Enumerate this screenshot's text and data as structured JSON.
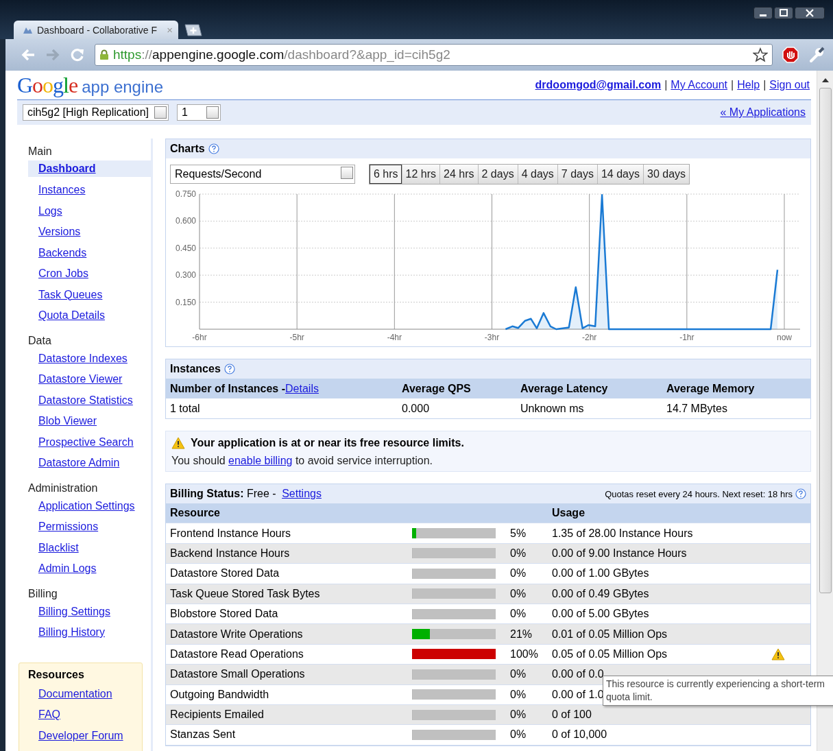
{
  "browser": {
    "tab_title": "Dashboard - Collaborative F",
    "tab_close": "×",
    "url_scheme": "https",
    "url_sep": "://",
    "url_host": "appengine.google.com",
    "url_path": "/dashboard?&app_id=cih5g2"
  },
  "header": {
    "logo_google": "Google",
    "logo_product": "app engine",
    "user_email": "drdoomgod@gmail.com",
    "separators": [
      "|",
      "|",
      "|"
    ],
    "links": [
      "My Account",
      "Help",
      "Sign out"
    ]
  },
  "app_bar": {
    "app_select": "cih5g2 [High Replication]",
    "version_select": "1",
    "my_applications": "« My Applications"
  },
  "sidebar": {
    "sections": [
      {
        "title": "Main",
        "items": [
          {
            "label": "Dashboard",
            "selected": true
          },
          {
            "label": "Instances",
            "selected": false
          },
          {
            "label": "Logs",
            "selected": false
          },
          {
            "label": "Versions",
            "selected": false
          },
          {
            "label": "Backends",
            "selected": false
          },
          {
            "label": "Cron Jobs",
            "selected": false
          },
          {
            "label": "Task Queues",
            "selected": false
          },
          {
            "label": "Quota Details",
            "selected": false
          }
        ]
      },
      {
        "title": "Data",
        "items": [
          {
            "label": "Datastore Indexes",
            "selected": false
          },
          {
            "label": "Datastore Viewer",
            "selected": false
          },
          {
            "label": "Datastore Statistics",
            "selected": false
          },
          {
            "label": "Blob Viewer",
            "selected": false
          },
          {
            "label": "Prospective Search",
            "selected": false
          },
          {
            "label": "Datastore Admin",
            "selected": false
          }
        ]
      },
      {
        "title": "Administration",
        "items": [
          {
            "label": "Application Settings",
            "selected": false
          },
          {
            "label": "Permissions",
            "selected": false
          },
          {
            "label": "Blacklist",
            "selected": false
          },
          {
            "label": "Admin Logs",
            "selected": false
          }
        ]
      },
      {
        "title": "Billing",
        "items": [
          {
            "label": "Billing Settings",
            "selected": false
          },
          {
            "label": "Billing History",
            "selected": false
          }
        ]
      }
    ],
    "resources": {
      "title": "Resources",
      "items": [
        "Documentation",
        "FAQ",
        "Developer Forum"
      ]
    }
  },
  "charts": {
    "title": "Charts",
    "metric_select": "Requests/Second",
    "ranges": [
      {
        "label": "6 hrs",
        "selected": true
      },
      {
        "label": "12 hrs",
        "selected": false
      },
      {
        "label": "24 hrs",
        "selected": false
      },
      {
        "label": "2 days",
        "selected": false
      },
      {
        "label": "4 days",
        "selected": false
      },
      {
        "label": "7 days",
        "selected": false
      },
      {
        "label": "14 days",
        "selected": false
      },
      {
        "label": "30 days",
        "selected": false
      }
    ],
    "chart_data": {
      "type": "area",
      "grid": true,
      "x": [
        -2.86,
        -2.79,
        -2.73,
        -2.66,
        -2.6,
        -2.54,
        -2.47,
        -2.4,
        -2.34,
        -2.21,
        -2.14,
        -2.07,
        -2.01,
        -1.94,
        -1.87,
        -1.8,
        -0.14,
        -0.07
      ],
      "series": [
        {
          "color": "#1a7ad4",
          "values": [
            0,
            0.016,
            0.007,
            0.047,
            0.058,
            0.005,
            0.09,
            0.016,
            0,
            0.01,
            0.233,
            0.005,
            0.023,
            0.016,
            0.745,
            0,
            0,
            0.33
          ]
        }
      ],
      "xlim": [
        -6,
        0
      ],
      "ylim": [
        0,
        0.75
      ],
      "xticks": [
        {
          "value": -6,
          "label": "-6hr"
        },
        {
          "value": -5,
          "label": "-5hr"
        },
        {
          "value": -4,
          "label": "-4hr"
        },
        {
          "value": -3,
          "label": "-3hr"
        },
        {
          "value": -2,
          "label": "-2hr"
        },
        {
          "value": -1,
          "label": "-1hr"
        },
        {
          "value": 0,
          "label": "now"
        }
      ],
      "yticks": [
        {
          "value": 0.15,
          "label": "0.150"
        },
        {
          "value": 0.3,
          "label": "0.300"
        },
        {
          "value": 0.45,
          "label": "0.450"
        },
        {
          "value": 0.6,
          "label": "0.600"
        },
        {
          "value": 0.75,
          "label": "0.750"
        }
      ]
    }
  },
  "instances": {
    "title": "Instances",
    "col_count_label": "Number of Instances - ",
    "details_link": "Details",
    "columns": [
      "Average QPS",
      "Average Latency",
      "Average Memory"
    ],
    "row": [
      "1 total",
      "0.000",
      "Unknown ms",
      "14.7 MBytes"
    ]
  },
  "warning": {
    "headline": "Your application is at or near its free resource limits.",
    "before": "You should ",
    "link": "enable billing",
    "after": " to avoid service interruption."
  },
  "billing": {
    "label": "Billing Status:",
    "status": "Free - ",
    "settings_link": "Settings",
    "reset_note": "Quotas reset every 24 hours. Next reset: 18 hrs"
  },
  "resources": {
    "columns": [
      "Resource",
      "Usage"
    ],
    "rows": [
      {
        "name": "Frontend Instance Hours",
        "level": 0.05,
        "color": "#00b000",
        "percent": "5%",
        "usage": "1.35 of 28.00 Instance Hours",
        "warning": false
      },
      {
        "name": "Backend Instance Hours",
        "level": 0,
        "percent": "0%",
        "usage": "0.00 of 9.00 Instance Hours",
        "warning": false
      },
      {
        "name": "Datastore Stored Data",
        "level": 0,
        "percent": "0%",
        "usage": "0.00 of 1.00 GBytes",
        "warning": false
      },
      {
        "name": "Task Queue Stored Task Bytes",
        "level": 0,
        "percent": "0%",
        "usage": "0.00 of 0.49 GBytes",
        "warning": false
      },
      {
        "name": "Blobstore Stored Data",
        "level": 0,
        "percent": "0%",
        "usage": "0.00 of 5.00 GBytes",
        "warning": false
      },
      {
        "name": "Datastore Write Operations",
        "level": 0.21,
        "color": "#00b000",
        "percent": "21%",
        "usage": "0.01 of 0.05 Million Ops",
        "warning": false
      },
      {
        "name": "Datastore Read Operations",
        "level": 1,
        "color": "#cc0000",
        "percent": "100%",
        "usage": "0.05 of 0.05 Million Ops",
        "warning": true
      },
      {
        "name": "Datastore Small Operations",
        "level": 0,
        "percent": "0%",
        "usage": "0.00 of 0.0",
        "warning": false
      },
      {
        "name": "Outgoing Bandwidth",
        "level": 0,
        "percent": "0%",
        "usage": "0.00 of 1.0",
        "warning": false
      },
      {
        "name": "Recipients Emailed",
        "level": 0,
        "percent": "0%",
        "usage": "0 of 100",
        "warning": false
      },
      {
        "name": "Stanzas Sent",
        "level": 0,
        "percent": "0%",
        "usage": "0 of 10,000",
        "warning": false
      }
    ],
    "tooltip": "This resource is currently experiencing a short-term quota limit."
  }
}
